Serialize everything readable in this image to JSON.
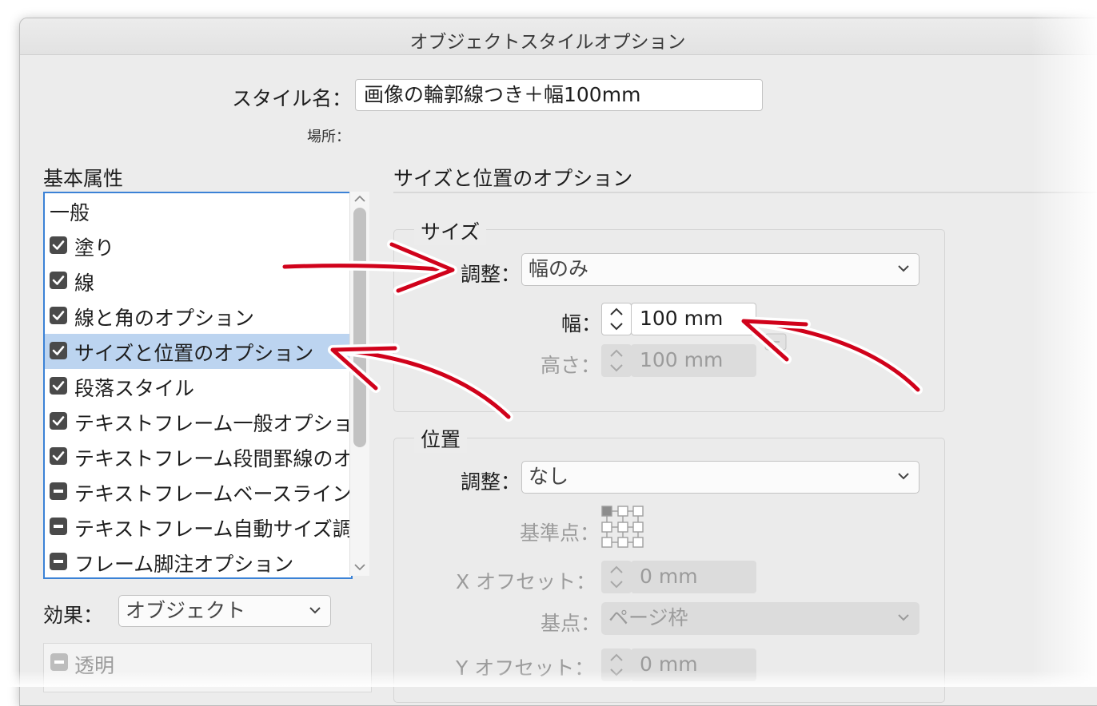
{
  "window": {
    "title": "オブジェクトスタイルオプション"
  },
  "style_name": {
    "label": "スタイル名：",
    "value": "画像の輪郭線つき＋幅100mm"
  },
  "location": {
    "label": "場所："
  },
  "basic_attributes": {
    "heading": "基本属性",
    "items": [
      {
        "label": "一般",
        "state": "none"
      },
      {
        "label": "塗り",
        "state": "checked"
      },
      {
        "label": "線",
        "state": "checked"
      },
      {
        "label": "線と角のオプション",
        "state": "checked"
      },
      {
        "label": "サイズと位置のオプション",
        "state": "checked",
        "selected": true
      },
      {
        "label": "段落スタイル",
        "state": "checked"
      },
      {
        "label": "テキストフレーム一般オプション",
        "state": "checked"
      },
      {
        "label": "テキストフレーム段間罫線のオプション",
        "state": "checked"
      },
      {
        "label": "テキストフレームベースラインオプション",
        "state": "mixed"
      },
      {
        "label": "テキストフレーム自動サイズ調整オプション",
        "state": "mixed"
      },
      {
        "label": "フレーム脚注オプション",
        "state": "mixed"
      }
    ]
  },
  "effects": {
    "label": "効果：",
    "select_value": "オブジェクト",
    "items": [
      {
        "label": "透明",
        "state": "mixed"
      }
    ]
  },
  "panel": {
    "title": "サイズと位置のオプション",
    "size_group": {
      "title": "サイズ",
      "adjust_label": "調整：",
      "adjust_value": "幅のみ",
      "width_label": "幅：",
      "width_value": "100 mm",
      "height_label": "高さ：",
      "height_value": "100 mm"
    },
    "position_group": {
      "title": "位置",
      "adjust_label": "調整：",
      "adjust_value": "なし",
      "refpoint_label": "基準点：",
      "x_offset_label": "X オフセット：",
      "x_offset_value": "0 mm",
      "base_label": "基点：",
      "base_value": "ページ枠",
      "y_offset_label": "Y オフセット：",
      "y_offset_value": "0 mm"
    }
  },
  "colors": {
    "accent": "#3b82d6",
    "selection": "#bcd4f0",
    "annotation_arrow": "#d0021b"
  }
}
